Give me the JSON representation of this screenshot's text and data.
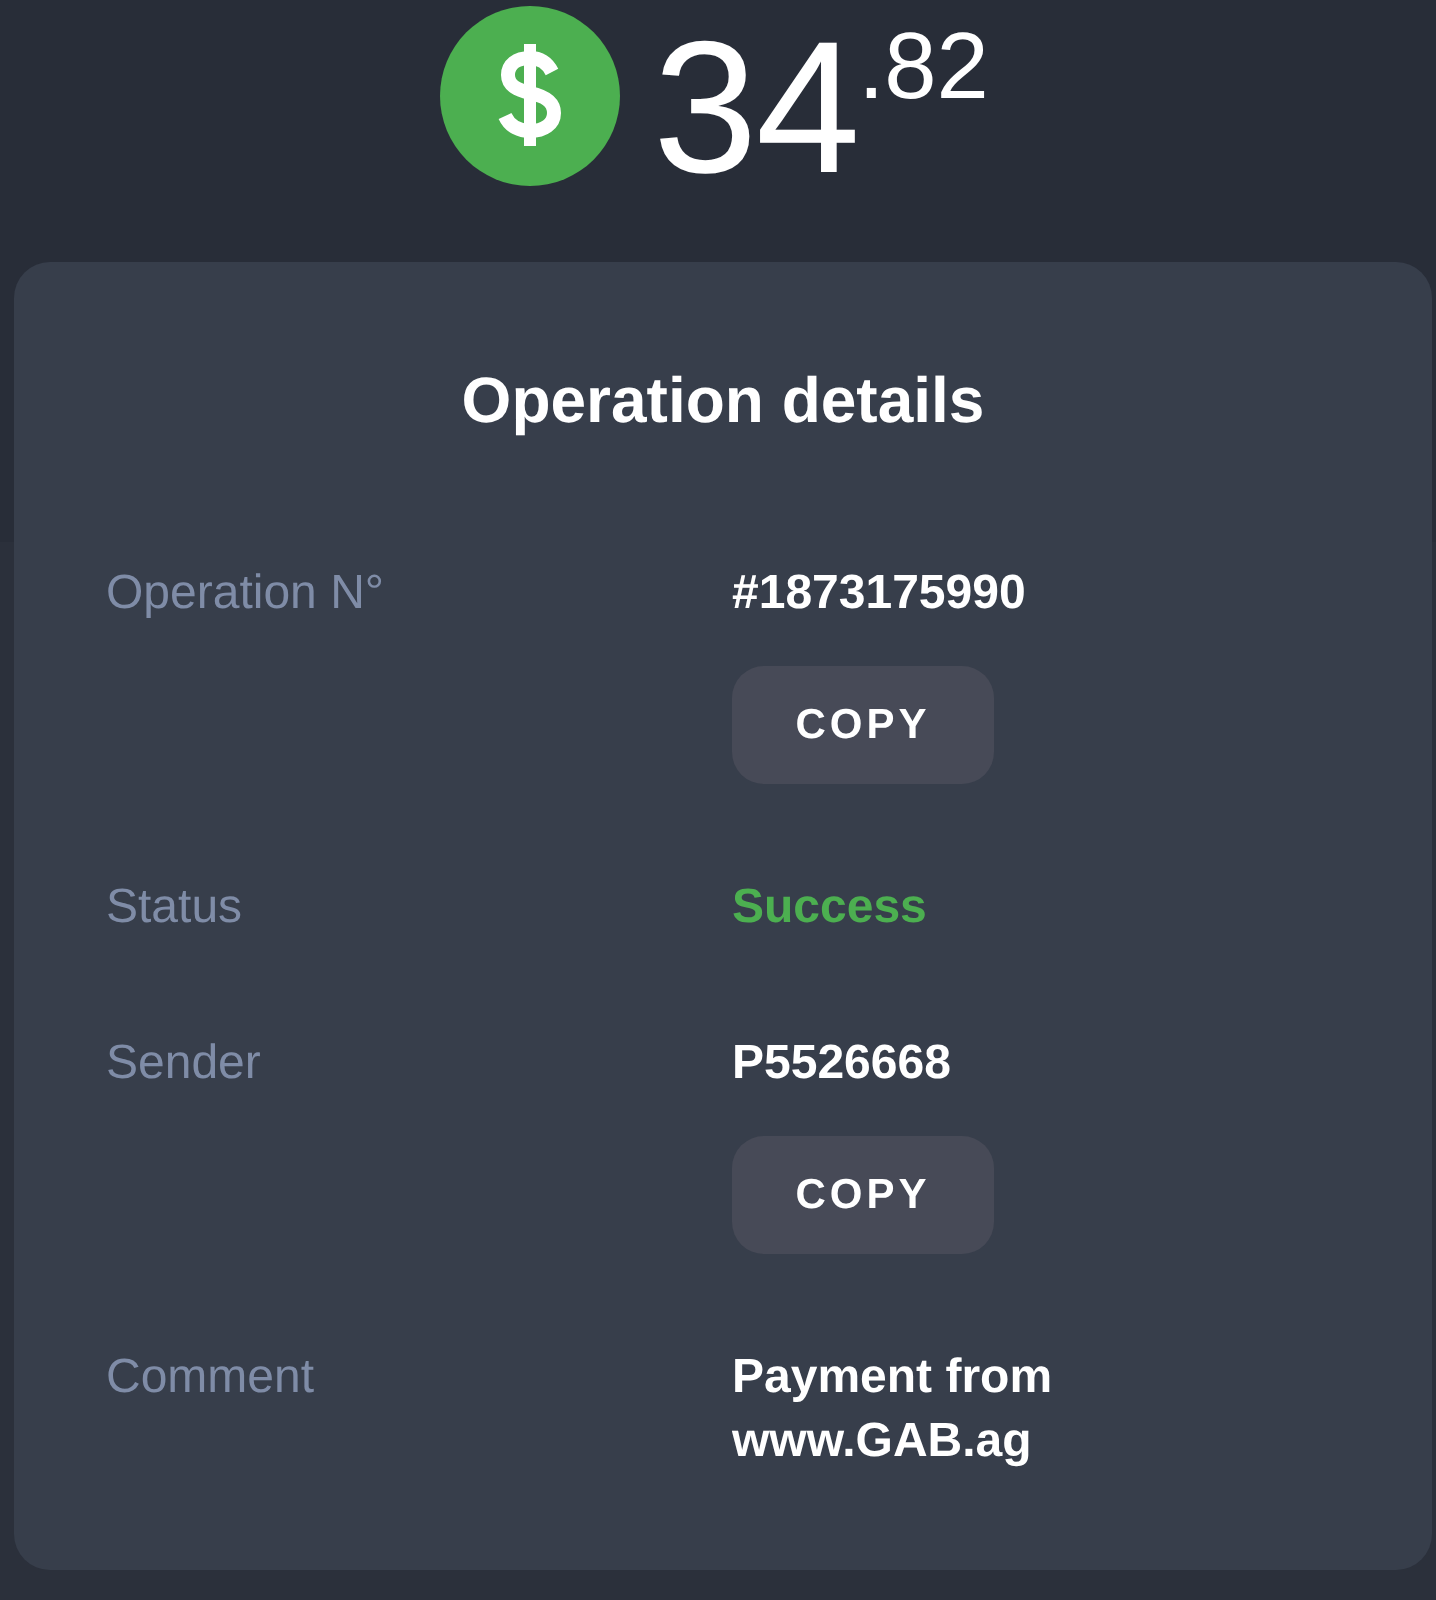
{
  "amount": {
    "whole": "34",
    "fraction": ".82"
  },
  "details": {
    "title": "Operation details",
    "rows": [
      {
        "kind": "copyable",
        "label": "Operation N°",
        "value": "#1873175990",
        "button": "COPY"
      },
      {
        "kind": "status",
        "label": "Status",
        "value": "Success"
      },
      {
        "kind": "copyable",
        "label": "Sender",
        "value": "P5526668",
        "button": "COPY"
      },
      {
        "kind": "text",
        "label": "Comment",
        "value": "Payment from www.GAB.ag"
      }
    ]
  }
}
